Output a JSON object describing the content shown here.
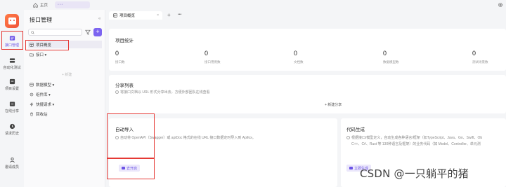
{
  "topbar": {
    "home_label": "主页",
    "tab_dots": "•••"
  },
  "rail": {
    "items": [
      {
        "label": "接口管理",
        "icon": "api-management-icon"
      },
      {
        "label": "自动化测试",
        "icon": "automation-test-icon"
      },
      {
        "label": "项目设置",
        "icon": "project-settings-icon"
      },
      {
        "label": "在线分享",
        "icon": "online-share-icon"
      },
      {
        "label": "请求历史",
        "icon": "request-history-icon"
      },
      {
        "label": "邀请成员",
        "icon": "invite-member-icon"
      }
    ]
  },
  "sidebar": {
    "title": "接口管理",
    "collapse": "«",
    "add": "+",
    "items": [
      {
        "label": "项目概览"
      },
      {
        "label": "接口 ▾"
      },
      {
        "label": "数据模型 ▾"
      },
      {
        "label": "组件库 ▾"
      },
      {
        "label": "快捷请求 ▾"
      },
      {
        "label": "回收站"
      }
    ],
    "new_placeholder": "+ 新建"
  },
  "tabs": {
    "active_label": "项目概览",
    "close": "×",
    "plus": "+",
    "more": "•••"
  },
  "stats": {
    "title": "项目统计",
    "items": [
      {
        "value": "0",
        "label": "接口数"
      },
      {
        "value": "0",
        "label": "接口用例数"
      },
      {
        "value": "0",
        "label": "文档数"
      },
      {
        "value": "0",
        "label": "数据模型数"
      },
      {
        "value": "0",
        "label": "测试场景数"
      }
    ]
  },
  "share": {
    "title": "分享列表",
    "desc": "将接口文档以 URL 形式分享出去，方便外部团队在线查看",
    "new_button": "+ 新建分享"
  },
  "auto_import": {
    "title": "自动导入",
    "desc": "自动将 OpenAPI（Swagger）或 apiDoc 格式的在线 URL 接口数据定时导入到 Apifox。",
    "button": "去开启"
  },
  "codegen": {
    "title": "代码生成",
    "desc_line1": "根据接口/模型定义，自动生成各种语言/框架（如TypeScript、Java、Go、Swift、Ob",
    "desc_line2": "C++、C#、Rust 等 130种语言及框架）的业务代码（如 Model、Controller、单元测",
    "button": "立即生成"
  },
  "watermark": "CSDN @一只躺平的猪",
  "colors": {
    "accent": "#6b53e6",
    "highlight_box": "#e53935",
    "logo": "#f0533a"
  }
}
